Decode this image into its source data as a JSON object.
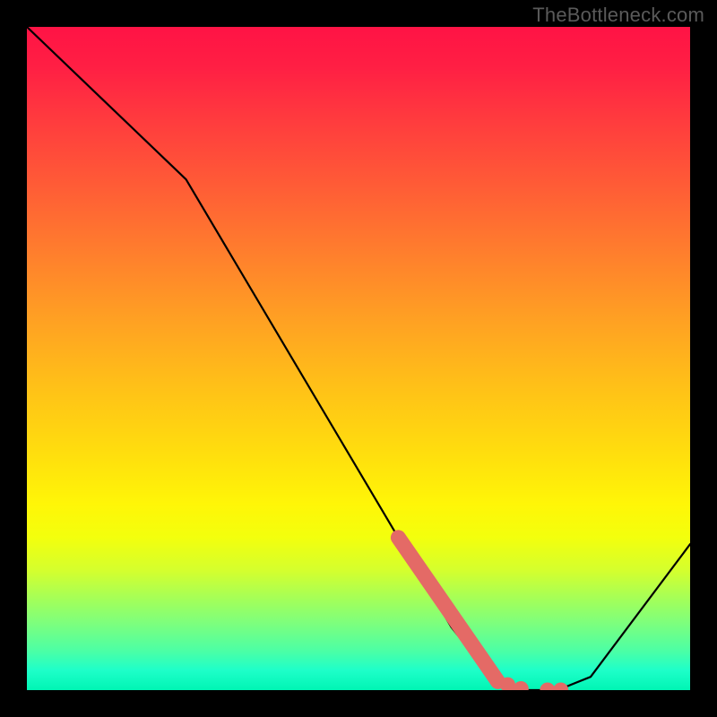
{
  "watermark": "TheBottleneck.com",
  "chart_data": {
    "type": "line",
    "title": "",
    "xlabel": "",
    "ylabel": "",
    "xlim": [
      0,
      100
    ],
    "ylim": [
      0,
      100
    ],
    "x": [
      0,
      24,
      64,
      70,
      75,
      80,
      85,
      100
    ],
    "values": [
      100,
      77,
      9.5,
      2,
      0,
      0,
      2,
      22
    ],
    "highlight_segment": {
      "x": [
        56,
        71
      ],
      "values": [
        23,
        1.3
      ]
    },
    "highlight_dots": [
      {
        "x": 72.5,
        "y": 0.8
      },
      {
        "x": 74.5,
        "y": 0.2
      },
      {
        "x": 78.5,
        "y": 0.0
      },
      {
        "x": 80.5,
        "y": 0.0
      }
    ]
  }
}
